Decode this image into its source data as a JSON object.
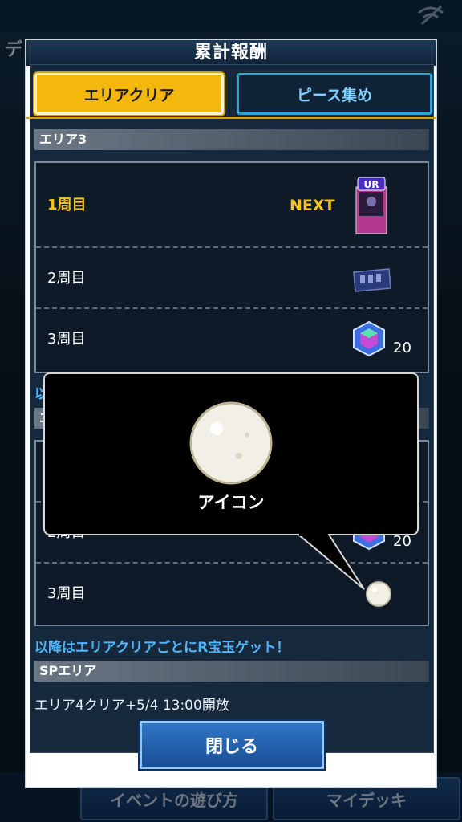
{
  "background": {
    "title_fragment": "デュ",
    "bottom_buttons": [
      "イベントの遊び方",
      "マイデッキ"
    ]
  },
  "modal": {
    "title": "累計報酬",
    "tabs": [
      {
        "label": "エリアクリア",
        "active": true
      },
      {
        "label": "ピース集め",
        "active": false
      }
    ],
    "area3": {
      "header": "エリア3",
      "rows": [
        {
          "label": "1周目",
          "status": "NEXT",
          "reward_icon": "ur-card-icon",
          "badge": "UR"
        },
        {
          "label": "2周目",
          "reward_icon": "card-sleeve-icon"
        },
        {
          "label": "3周目",
          "reward_icon": "gem-icon",
          "quantity": "20"
        }
      ]
    },
    "partial_info_prefix": "以",
    "area4_partial": {
      "header_prefix": "エ",
      "rows": [
        {
          "label": "2周目",
          "reward_icon": "gem-icon",
          "quantity": "20"
        },
        {
          "label": "3周目",
          "reward_icon": "white-orb-icon"
        }
      ]
    },
    "info_line": "以降はエリアクリアごとにR宝玉ゲット！",
    "sp_area": {
      "header": "SPエリア",
      "text": "エリア4クリア+5/4 13:00開放"
    },
    "close_button": "閉じる"
  },
  "tooltip": {
    "label": "アイコン",
    "icon": "white-orb-icon"
  },
  "colors": {
    "active_tab": "#f3b70e",
    "inactive_tab_text": "#7fd0ff",
    "next_highlight": "#f5c518",
    "info_text": "#4fb6ff",
    "close_button": "#2f76c6"
  }
}
